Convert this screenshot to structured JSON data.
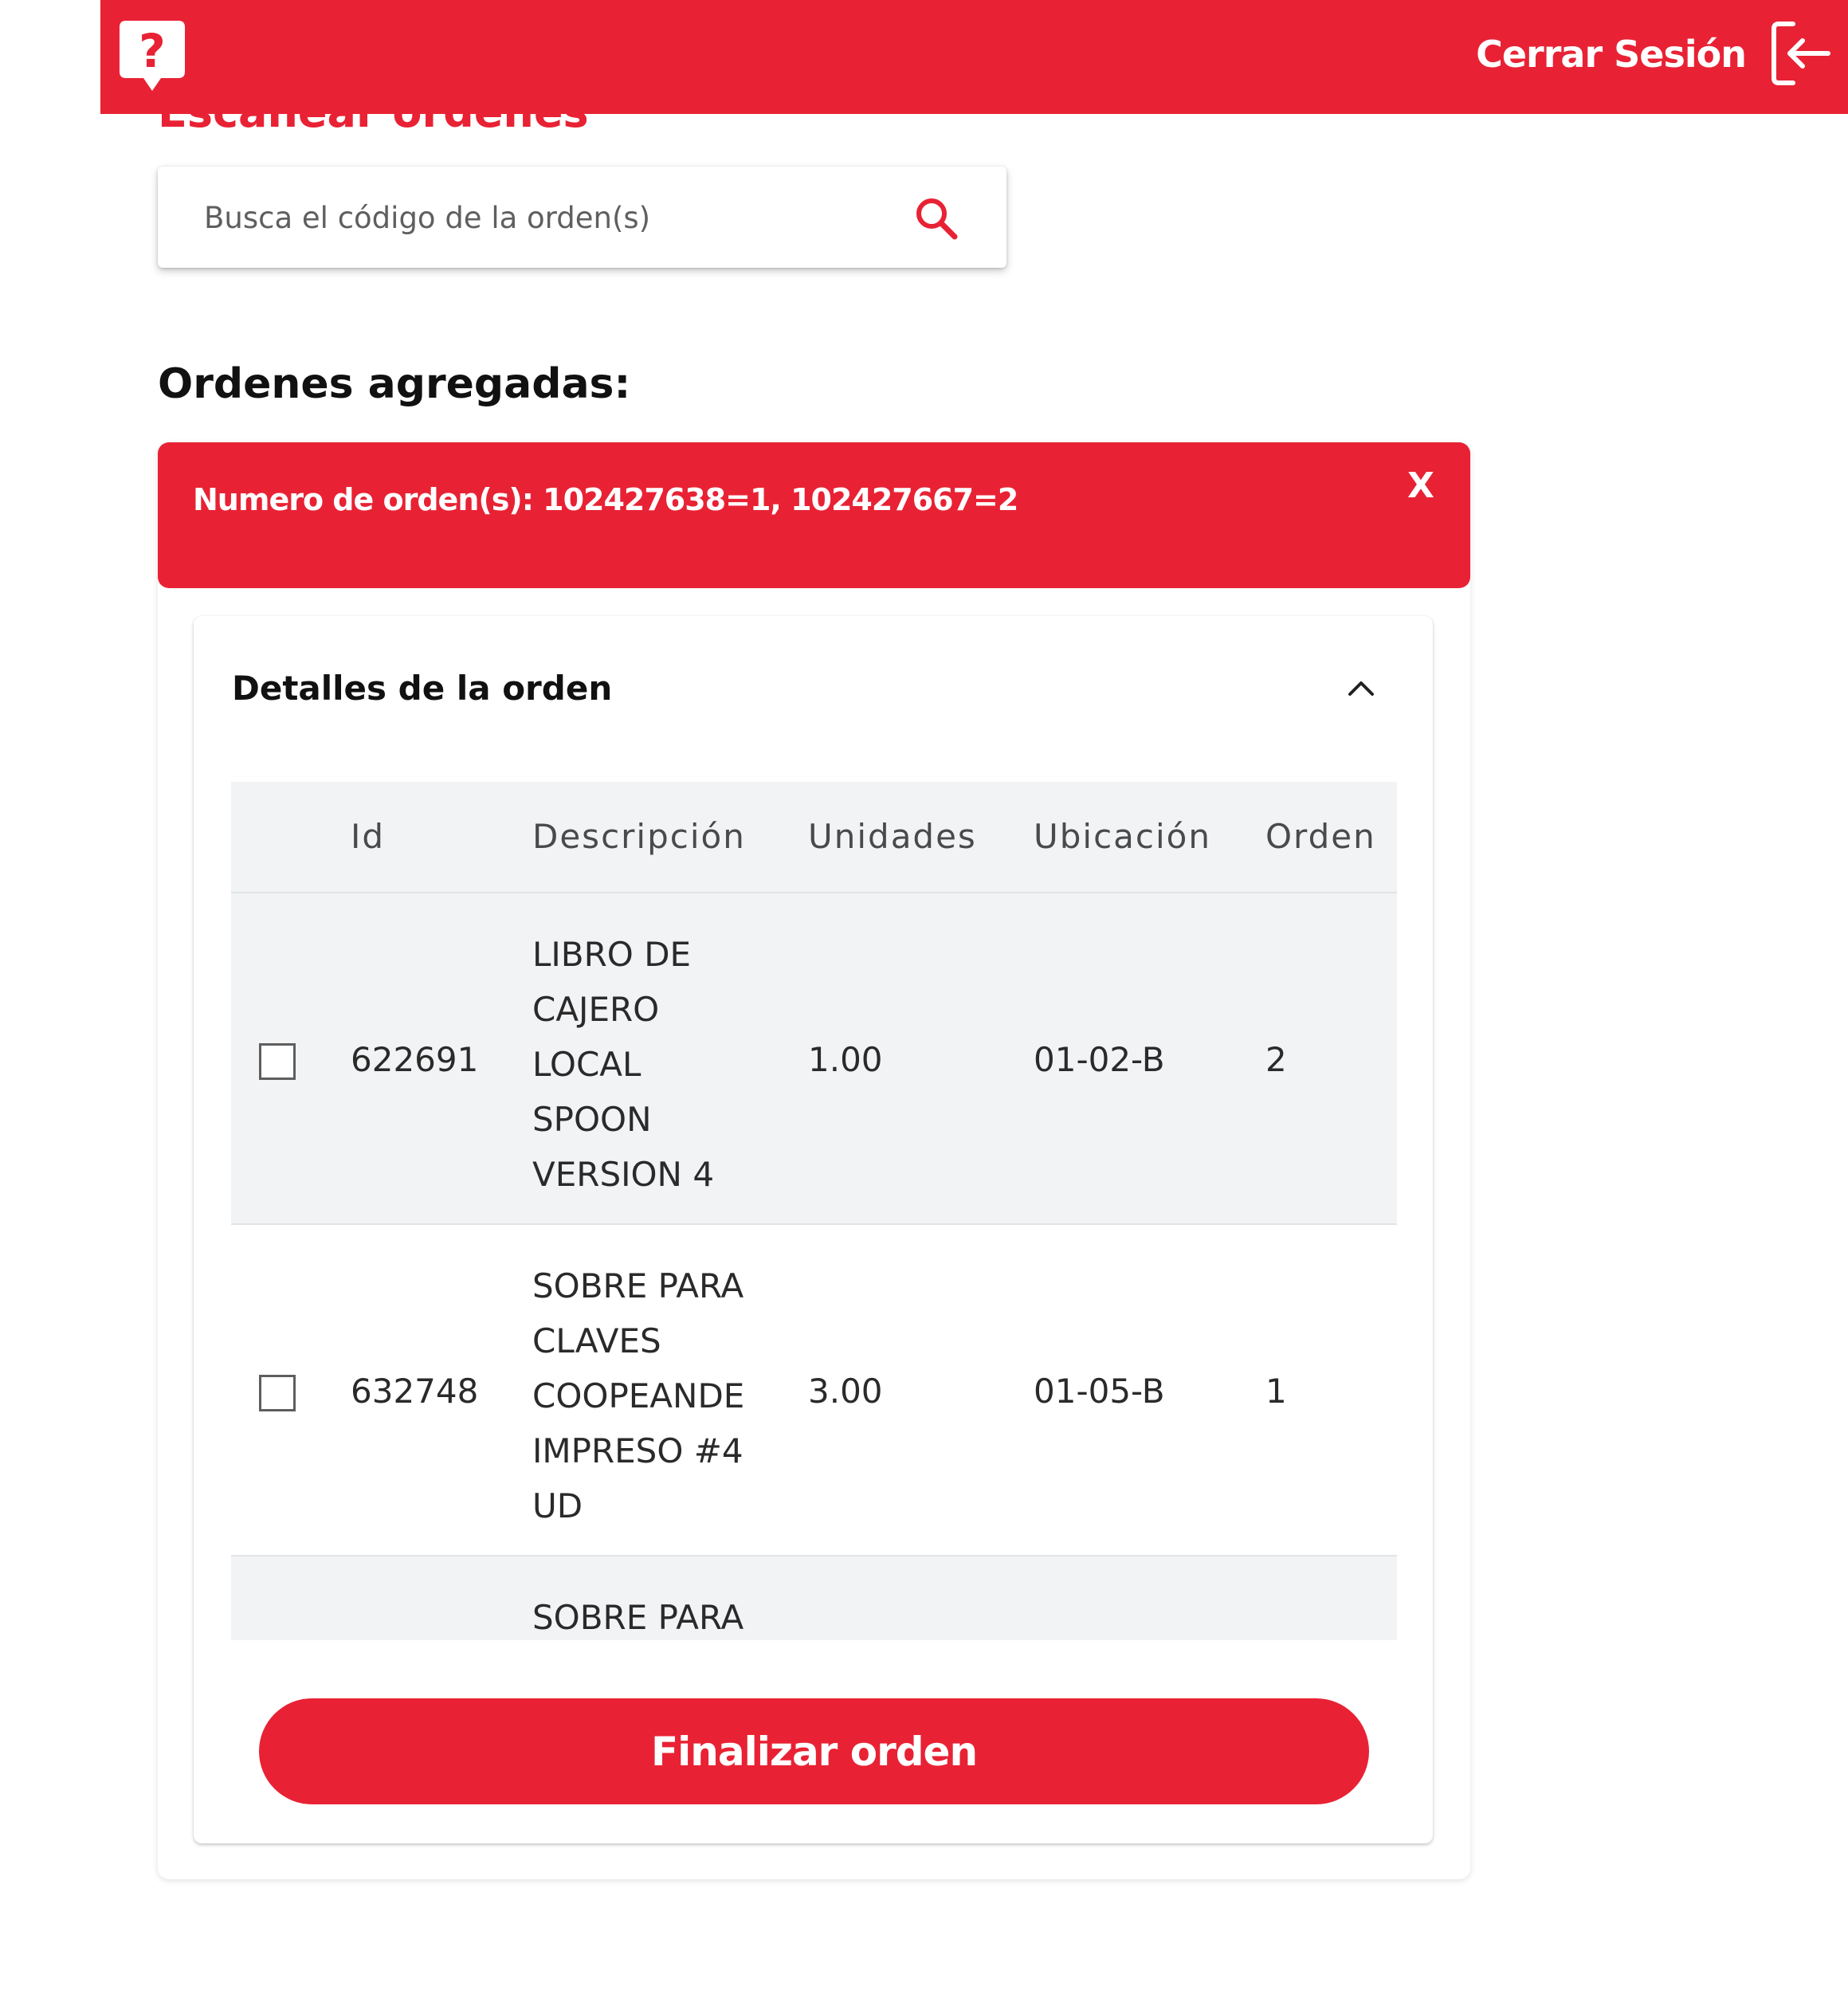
{
  "header": {
    "help_icon": "help-question-icon",
    "logout_label": "Cerrar Sesión",
    "logout_icon": "logout-icon",
    "background_color": "#E82234"
  },
  "page": {
    "title": "Escanear órdenes"
  },
  "search": {
    "placeholder": "Busca el código de la orden(s)",
    "icon": "search-icon"
  },
  "orders_section": {
    "heading": "Ordenes agregadas:",
    "banner_text": "Numero de orden(s): 102427638=1, 102427667=2",
    "close_label": "X"
  },
  "details": {
    "title": "Detalles de la orden",
    "toggle_icon": "chevron-up-icon",
    "columns": {
      "id": "Id",
      "description": "Descripción",
      "units": "Unidades",
      "location": "Ubicación",
      "order": "Orden"
    },
    "rows": [
      {
        "id": "622691",
        "description": "LIBRO DE\nCAJERO\nLOCAL\nSPOON\nVERSION 4",
        "units": "1.00",
        "location": "01-02-B",
        "order": "2",
        "checked": false
      },
      {
        "id": "632748",
        "description": "SOBRE PARA\nCLAVES\nCOOPEANDE\nIMPRESO #4\nUD",
        "units": "3.00",
        "location": "01-05-B",
        "order": "1",
        "checked": false
      },
      {
        "id": "",
        "description": "SOBRE PARA",
        "units": "",
        "location": "",
        "order": "",
        "checked": false
      }
    ]
  },
  "actions": {
    "finalize_label": "Finalizar orden",
    "accent_color": "#E82234"
  }
}
